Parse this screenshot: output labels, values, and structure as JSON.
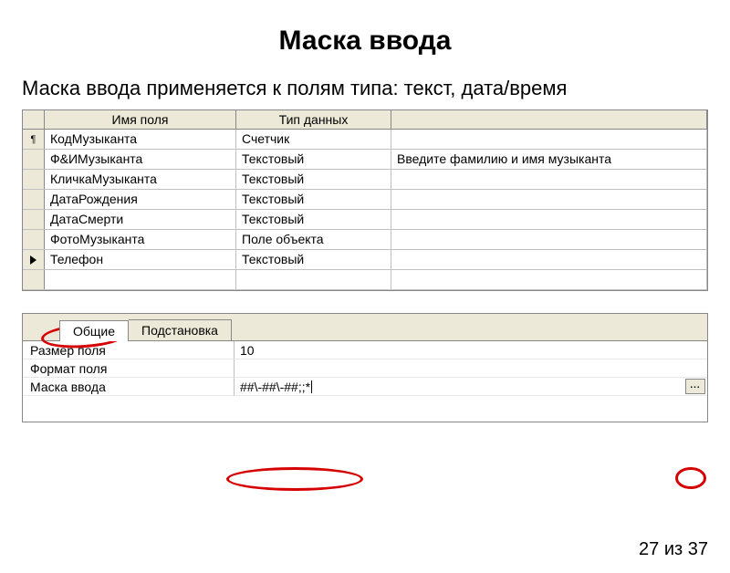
{
  "slide": {
    "title": "Маска ввода",
    "subtitle": "Маска ввода применяется к полям типа: текст, дата/время"
  },
  "grid": {
    "headers": {
      "name": "Имя поля",
      "type": "Тип данных",
      "desc": ""
    },
    "rows": [
      {
        "selector": "key",
        "name": "КодМузыканта",
        "type": "Счетчик",
        "desc": ""
      },
      {
        "selector": "",
        "name": "Ф&ИМузыканта",
        "type": "Текстовый",
        "desc": "Введите фамилию и имя  музыканта"
      },
      {
        "selector": "",
        "name": "КличкаМузыканта",
        "type": "Текстовый",
        "desc": ""
      },
      {
        "selector": "",
        "name": "ДатаРождения",
        "type": "Текстовый",
        "desc": ""
      },
      {
        "selector": "",
        "name": "ДатаСмерти",
        "type": "Текстовый",
        "desc": ""
      },
      {
        "selector": "",
        "name": "ФотоМузыканта",
        "type": "Поле объекта",
        "desc": ""
      },
      {
        "selector": "arrow",
        "name": "Телефон",
        "type": "Текстовый",
        "desc": ""
      },
      {
        "selector": "",
        "name": "",
        "type": "",
        "desc": ""
      }
    ]
  },
  "tabs": {
    "general": "Общие",
    "lookup": "Подстановка"
  },
  "properties": {
    "field_size_label": "Размер поля",
    "field_size_value": "10",
    "format_label": "Формат поля",
    "format_value": "",
    "mask_label": "Маска ввода",
    "mask_value": "##\\-##\\-##;;*"
  },
  "builder_button": "...",
  "footer": {
    "counter": "27 из 37"
  }
}
